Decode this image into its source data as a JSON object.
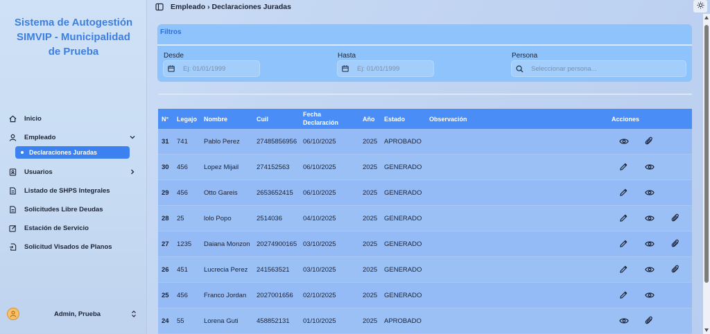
{
  "sidebar": {
    "brand": "Sistema de Autogestión SIMVIP - Municipalidad de Prueba",
    "items": [
      {
        "label": "Inicio",
        "icon": "home-icon"
      },
      {
        "label": "Empleado",
        "icon": "user-icon"
      },
      {
        "label": "Usuarios",
        "icon": "contact-icon"
      },
      {
        "label": "Listado de SHPS Integrales",
        "icon": "document-icon"
      },
      {
        "label": "Solicitudes Libre Deudas",
        "icon": "document-icon"
      },
      {
        "label": "Estación de Servicio",
        "icon": "edit-icon"
      },
      {
        "label": "Solicitud Visados de Planos",
        "icon": "file-export-icon"
      }
    ],
    "sub_active": "Declaraciones Juradas",
    "user_name": "Admin, Prueba"
  },
  "topbar": {
    "breadcrumb": "Empleado › Declaraciones Juradas"
  },
  "filters": {
    "title": "Filtros",
    "desde_label": "Desde",
    "desde_placeholder": "Ej: 01/01/1999",
    "hasta_label": "Hasta",
    "hasta_placeholder": "Ej: 01/01/1999",
    "persona_label": "Persona",
    "persona_placeholder": "Seleccionar persona..."
  },
  "table": {
    "headers": {
      "num": "N°",
      "legajo": "Legajo",
      "nombre": "Nombre",
      "cuil": "Cuil",
      "fecha": "Fecha Declaración",
      "anio": "Año",
      "estado": "Estado",
      "observacion": "Observación",
      "acciones": "Acciones"
    },
    "rows": [
      {
        "num": "31",
        "legajo": "741",
        "nombre": "Pablo Perez",
        "cuil": "27485856956",
        "fecha": "06/10/2025",
        "anio": "2025",
        "estado": "APROBADO",
        "actions": [
          "view",
          "attach"
        ]
      },
      {
        "num": "30",
        "legajo": "456",
        "nombre": "Lopez Mijail",
        "cuil": "274152563",
        "fecha": "06/10/2025",
        "anio": "2025",
        "estado": "GENERADO",
        "actions": [
          "edit",
          "view"
        ]
      },
      {
        "num": "29",
        "legajo": "456",
        "nombre": "Otto Gareis",
        "cuil": "2653652415",
        "fecha": "06/10/2025",
        "anio": "2025",
        "estado": "GENERADO",
        "actions": [
          "edit",
          "view"
        ]
      },
      {
        "num": "28",
        "legajo": "25",
        "nombre": "lolo Popo",
        "cuil": "2514036",
        "fecha": "04/10/2025",
        "anio": "2025",
        "estado": "GENERADO",
        "actions": [
          "edit",
          "view",
          "attach"
        ]
      },
      {
        "num": "27",
        "legajo": "1235",
        "nombre": "Daiana Monzon",
        "cuil": "20274900165",
        "fecha": "03/10/2025",
        "anio": "2025",
        "estado": "GENERADO",
        "actions": [
          "edit",
          "view",
          "attach"
        ]
      },
      {
        "num": "26",
        "legajo": "451",
        "nombre": "Lucrecia Perez",
        "cuil": "241563521",
        "fecha": "03/10/2025",
        "anio": "2025",
        "estado": "GENERADO",
        "actions": [
          "edit",
          "view",
          "attach"
        ]
      },
      {
        "num": "25",
        "legajo": "456",
        "nombre": "Franco Jordan",
        "cuil": "2027001656",
        "fecha": "02/10/2025",
        "anio": "2025",
        "estado": "GENERADO",
        "actions": [
          "edit",
          "view"
        ]
      },
      {
        "num": "24",
        "legajo": "55",
        "nombre": "Lorena Guti",
        "cuil": "458852131",
        "fecha": "01/10/2025",
        "anio": "2025",
        "estado": "APROBADO",
        "actions": [
          "view",
          "attach"
        ]
      }
    ]
  },
  "colors": {
    "accent": "#3b82f0",
    "header": "#4a8df6",
    "brand": "#3d7fe0"
  }
}
